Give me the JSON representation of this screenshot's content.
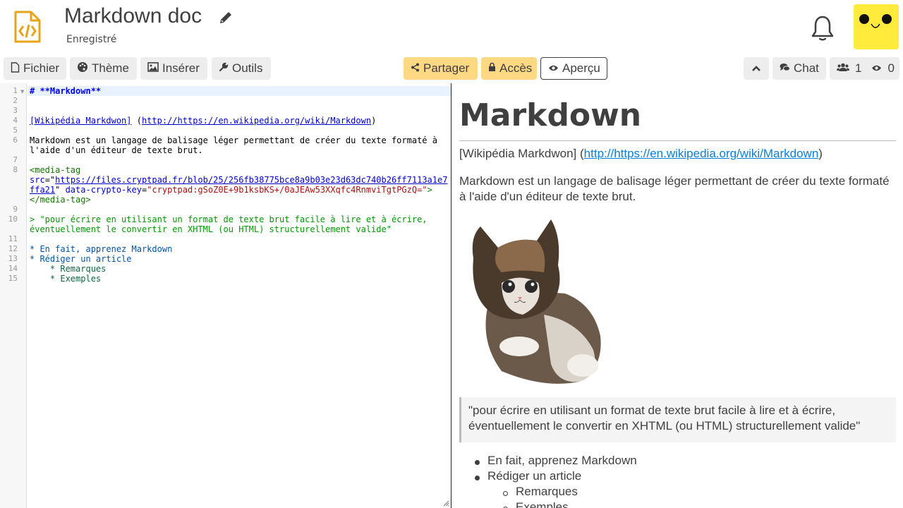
{
  "header": {
    "title": "Markdown doc",
    "status": "Enregistré"
  },
  "toolbar": {
    "file": "Fichier",
    "theme": "Thème",
    "insert": "Insérer",
    "tools": "Outils",
    "share": "Partager",
    "access": "Accès",
    "preview": "Aperçu",
    "chat": "Chat",
    "users_count": "1",
    "viewers_count": "0"
  },
  "editor": {
    "line_numbers": [
      "1",
      "2",
      "3",
      "4",
      "5",
      "6",
      "7",
      "8",
      "9",
      "10",
      "11",
      "12",
      "13",
      "14",
      "15"
    ],
    "line1": "# **Markdown**",
    "line4_link_text": "[Wikipédia Markdwon]",
    "line4_url": "http://https://en.wikipedia.org/wiki/Markdown",
    "line6_a": "Markdown est un langage de balisage léger permettant de créer du texte formaté à",
    "line6_b": "l'aide d'un éditeur de texte brut.",
    "line8_tag_open": "<media-tag",
    "line8_src_attr": "src",
    "line8_src_a": "https://files.cryptpad.fr/blob/25/256fb38775bce8a9b03e23d63dc740b26ff7113a1e7",
    "line8_src_b": "ffa21",
    "line8_key_attr": "data-crypto-key",
    "line8_key_val": "\"cryptpad:gSoZ0E+9b1ksbKS+/0aJEAw53XXqfc4RnmviTgtPGzQ=\"",
    "line8_tag_close": "</media-tag>",
    "line10_a": "> \"pour écrire en utilisant un format de texte brut facile à lire et à écrire,",
    "line10_b": "éventuellement le convertir en XHTML (ou HTML) structurellement valide\"",
    "line12": "* En fait, apprenez Markdown",
    "line13": "* Rédiger un article",
    "line14": "    * Remarques",
    "line15": "    * Exemples"
  },
  "preview": {
    "heading": "Markdown",
    "wiki_text": "[Wikipédia Markdwon] (",
    "wiki_url": "http://https://en.wikipedia.org/wiki/Markdown",
    "wiki_close": ")",
    "paragraph": "Markdown est un langage de balisage léger permettant de créer du texte formaté à l'aide d'un éditeur de texte brut.",
    "quote": "\"pour écrire en utilisant un format de texte brut facile à lire et à écrire, éventuellement le convertir en XHTML (ou HTML) structurellement valide\"",
    "list": [
      "En fait, apprenez Markdown",
      "Rédiger un article"
    ],
    "sublist": [
      "Remarques",
      "Exemples"
    ]
  },
  "colors": {
    "accent_yellow": "#ffd883",
    "avatar_bg": "#ffeb3b",
    "doc_icon": "#e8a317",
    "link": "#0a7ed8"
  },
  "icons": {
    "doc": "code-file-icon",
    "edit": "pencil-icon",
    "notifications": "bell-icon",
    "file": "file-icon",
    "theme": "palette-icon",
    "insert": "image-icon",
    "tools": "wrench-icon",
    "share": "share-icon",
    "access": "lock-icon",
    "preview": "eye-icon",
    "collapse": "chevron-up-icon",
    "chat": "comments-icon",
    "users": "users-icon",
    "viewers": "eye-icon"
  }
}
